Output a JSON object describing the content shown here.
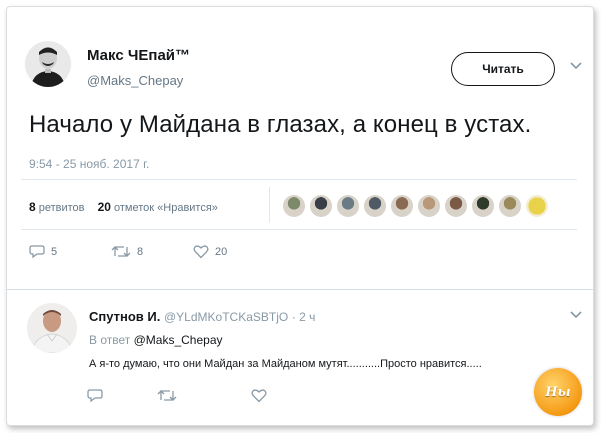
{
  "tweet": {
    "author_name": "Макс ЧЕпай™",
    "author_handle": "@Maks_Chepay",
    "follow_label": "Читать",
    "text": "Начало у Майдана в глазах, а конец в устах.",
    "timestamp": "9:54 - 25 нояб. 2017 г.",
    "retweets_count": "8",
    "retweets_label": "ретвитов",
    "likes_count": "20",
    "likes_label": "отметок «Нравится»",
    "liker_colors": [
      "#7d8a6a",
      "#3a3f47",
      "#6b7b85",
      "#4f5a64",
      "#8a6a52",
      "#b89878",
      "#7a5a44",
      "#2e3a2a",
      "#9a8a5a",
      "#d9c25a"
    ],
    "actions": {
      "reply_count": "5",
      "retweet_count": "8",
      "like_count": "20"
    }
  },
  "reply": {
    "author_name": "Спутнов И.",
    "author_handle": "@YLdMKoTCKaSBTjO",
    "time_ago": "· 2 ч",
    "reply_to_prefix": "В ответ",
    "reply_to_handle": "@Maks_Chepay",
    "text": "А я-то думаю, что они Майдан за Майданом мутят...........Просто нравится....."
  },
  "watermark": "Ны"
}
